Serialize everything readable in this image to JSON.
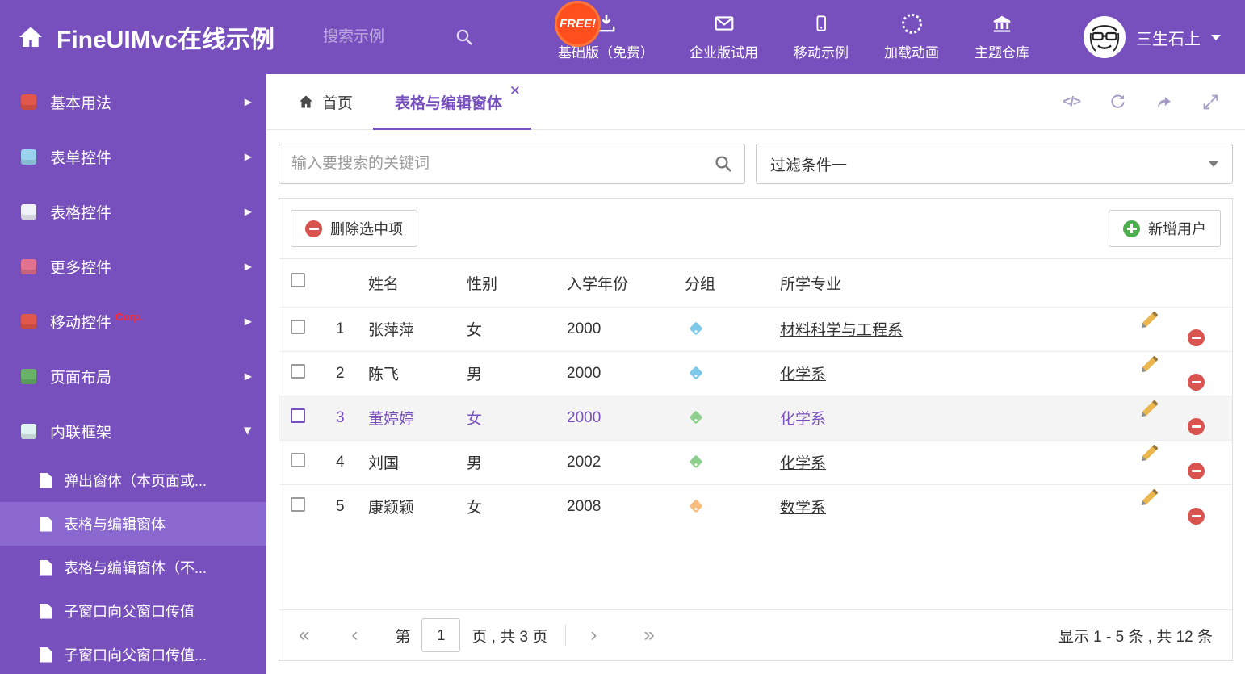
{
  "colors": {
    "accent": "#7850be",
    "accent_light": "#8a68cf",
    "free_badge_bg": "#ff4f1f",
    "corp_red": "#ff2b2b",
    "delete_red": "#d9534f",
    "add_green": "#4cae4c",
    "pencil_yellow": "#ecb64f",
    "selected_row_bg": "#f4f4f4"
  },
  "header": {
    "title": "FineUIMvc在线示例",
    "search_placeholder": "搜索示例",
    "free_badge": "FREE!",
    "nav": [
      {
        "icon": "download-icon",
        "label": "基础版（免费）"
      },
      {
        "icon": "envelope-icon",
        "label": "企业版试用"
      },
      {
        "icon": "mobile-icon",
        "label": "移动示例"
      },
      {
        "icon": "spinner-icon",
        "label": "加载动画"
      },
      {
        "icon": "bank-icon",
        "label": "主题仓库"
      }
    ],
    "user_name": "三生石上"
  },
  "sidebar": {
    "items": [
      {
        "label": "基本用法",
        "icon": "home-icon",
        "icon_color": "#e2574c"
      },
      {
        "label": "表单控件",
        "icon": "form-icon",
        "icon_color": "#9ad3ef"
      },
      {
        "label": "表格控件",
        "icon": "table-icon",
        "icon_color": "#f2f2fb"
      },
      {
        "label": "更多控件",
        "icon": "widgets-icon",
        "icon_color": "#e2728f"
      },
      {
        "label": "移动控件",
        "badge": "Corp.",
        "icon": "mobile-icon",
        "icon_color": "#e2574c"
      },
      {
        "label": "页面布局",
        "icon": "layout-icon",
        "icon_color": "#67b168"
      },
      {
        "label": "内联框架",
        "icon": "iframe-icon",
        "icon_color": "#dff3f1",
        "expanded": true
      }
    ],
    "subitems": [
      {
        "label": "弹出窗体（本页面或..."
      },
      {
        "label": "表格与编辑窗体",
        "active": true
      },
      {
        "label": "表格与编辑窗体（不..."
      },
      {
        "label": "子窗口向父窗口传值"
      },
      {
        "label": "子窗口向父窗口传值..."
      }
    ]
  },
  "tabs": {
    "home_label": "首页",
    "active_label": "表格与编辑窗体"
  },
  "filter": {
    "search_placeholder": "输入要搜索的关键词",
    "dropdown_value": "过滤条件一"
  },
  "toolbar": {
    "delete_label": "删除选中项",
    "add_label": "新增用户"
  },
  "table": {
    "headers": [
      "姓名",
      "性别",
      "入学年份",
      "分组",
      "所学专业"
    ],
    "rows": [
      {
        "num": "1",
        "name": "张萍萍",
        "gender": "女",
        "year": "2000",
        "tag_color": "#7ec8ea",
        "major": "材料科学与工程系"
      },
      {
        "num": "2",
        "name": "陈飞",
        "gender": "男",
        "year": "2000",
        "tag_color": "#7ec8ea",
        "major": "化学系"
      },
      {
        "num": "3",
        "name": "董婷婷",
        "gender": "女",
        "year": "2000",
        "tag_color": "#8fd08f",
        "major": "化学系",
        "selected": true
      },
      {
        "num": "4",
        "name": "刘国",
        "gender": "男",
        "year": "2002",
        "tag_color": "#8fd08f",
        "major": "化学系"
      },
      {
        "num": "5",
        "name": "康颖颖",
        "gender": "女",
        "year": "2008",
        "tag_color": "#f6bd7e",
        "major": "数学系"
      }
    ]
  },
  "pagination": {
    "page_label": "第",
    "page_value": "1",
    "total_label": "页 , 共 3 页",
    "summary": "显示 1 - 5 条 , 共 12 条"
  }
}
